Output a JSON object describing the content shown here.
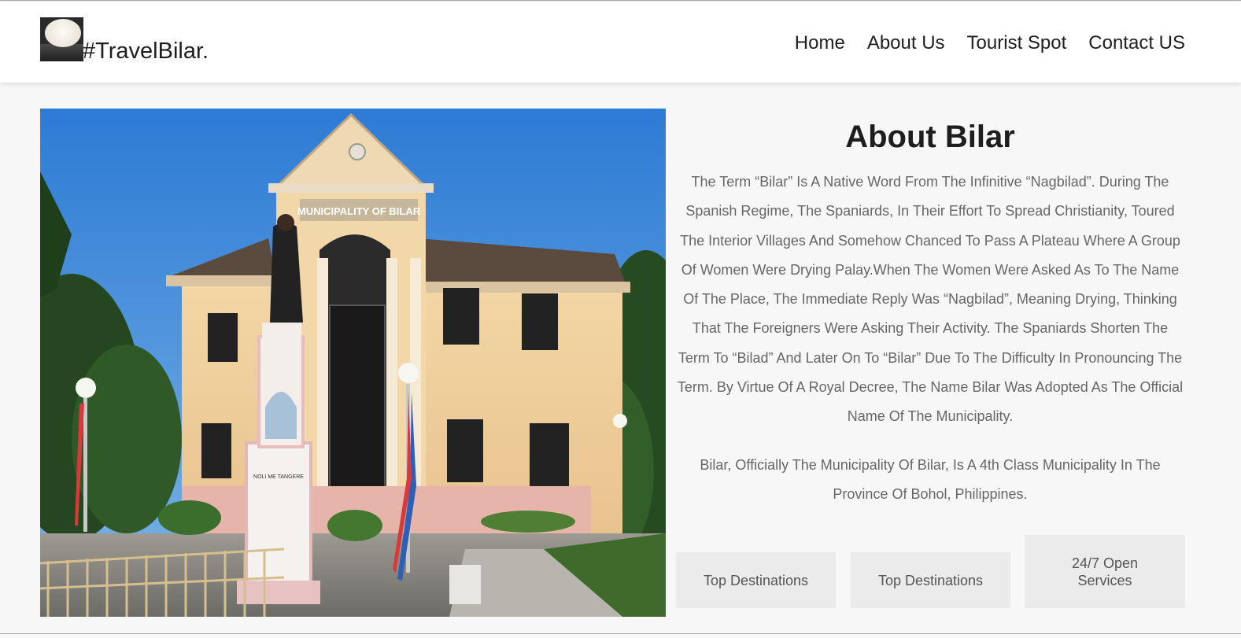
{
  "header": {
    "brand": "#TravelBilar.",
    "logo_icon": "bilar-hat-logo-icon",
    "nav": [
      {
        "label": "Home"
      },
      {
        "label": "About Us"
      },
      {
        "label": "Tourist Spot"
      },
      {
        "label": "Contact US"
      }
    ]
  },
  "hero_image": {
    "building_sign": "MUNICIPALITY OF BILAR",
    "plaque_text": "NOLI ME TANGERE"
  },
  "about": {
    "title": "About Bilar",
    "paragraph1": "The Term “Bilar” Is A Native Word From The Infinitive “Nagbilad”. During The Spanish Regime, The Spaniards, In Their Effort To Spread Christianity, Toured The Interior Villages And Somehow Chanced To Pass A Plateau Where A Group Of Women Were Drying Palay.When The Women Were Asked As To The Name Of The Place, The Immediate Reply Was “Nagbilad”, Meaning Drying, Thinking That The Foreigners Were Asking Their Activity. The Spaniards Shorten The Term To “Bilad” And Later On To “Bilar” Due To The Difficulty In Pronouncing The Term. By Virtue Of A Royal Decree, The Name Bilar Was Adopted As The Official Name Of The Municipality.",
    "paragraph2": "Bilar, Officially The Municipality Of Bilar, Is A 4th Class Municipality In The Province Of Bohol, Philippines."
  },
  "cards": [
    {
      "label": "Top Destinations"
    },
    {
      "label": "Top Destinations"
    },
    {
      "label": "24/7 Open Services"
    }
  ],
  "colors": {
    "header_bg": "#ffffff",
    "page_bg": "#f7f7f7",
    "card_bg": "#ebebeb",
    "body_text": "#666666",
    "title_text": "#1e1e1e"
  }
}
